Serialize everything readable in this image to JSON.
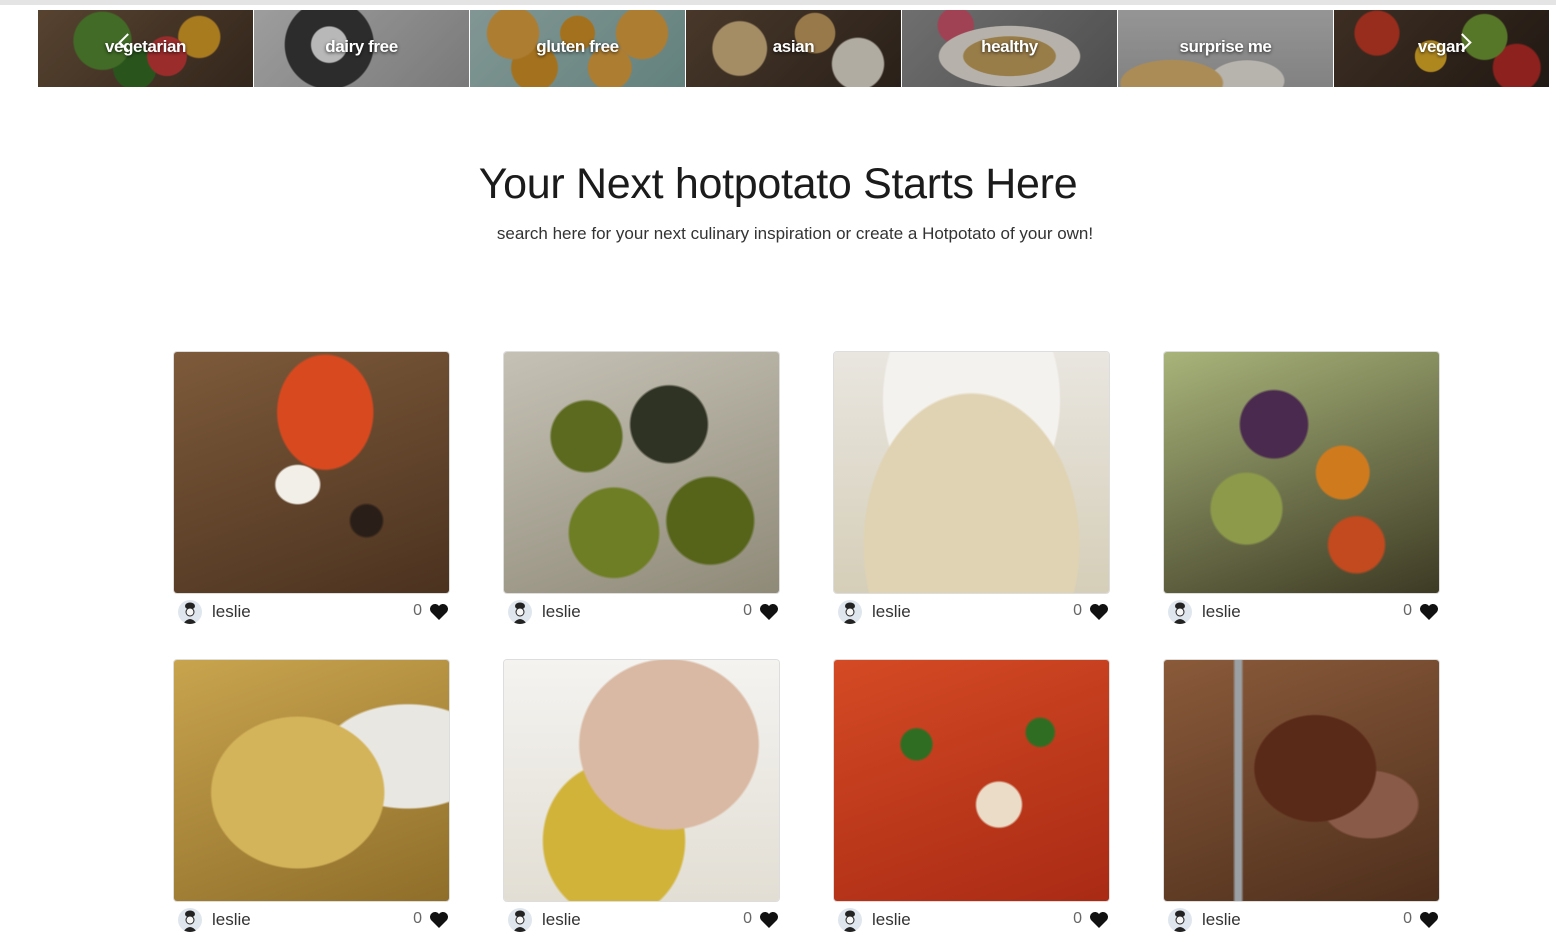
{
  "carousel": {
    "prev_icon": "chevron-left-icon",
    "next_icon": "chevron-right-icon",
    "categories": [
      {
        "label": "vegetarian"
      },
      {
        "label": "dairy free"
      },
      {
        "label": "gluten free"
      },
      {
        "label": "asian"
      },
      {
        "label": "healthy"
      },
      {
        "label": "surprise me"
      },
      {
        "label": "vegan"
      }
    ]
  },
  "hero": {
    "title": "Your Next hotpotato Starts Here",
    "subtitle": "search here for your next culinary inspiration or create a Hotpotato of your own!"
  },
  "recipes": [
    {
      "user": "leslie",
      "likes": "0"
    },
    {
      "user": "leslie",
      "likes": "0"
    },
    {
      "user": "leslie",
      "likes": "0"
    },
    {
      "user": "leslie",
      "likes": "0"
    },
    {
      "user": "leslie",
      "likes": "0"
    },
    {
      "user": "leslie",
      "likes": "0"
    },
    {
      "user": "leslie",
      "likes": "0"
    },
    {
      "user": "leslie",
      "likes": "0"
    }
  ],
  "colors": {
    "heart": "#111111",
    "avatar_bg": "#dfe6ee"
  }
}
